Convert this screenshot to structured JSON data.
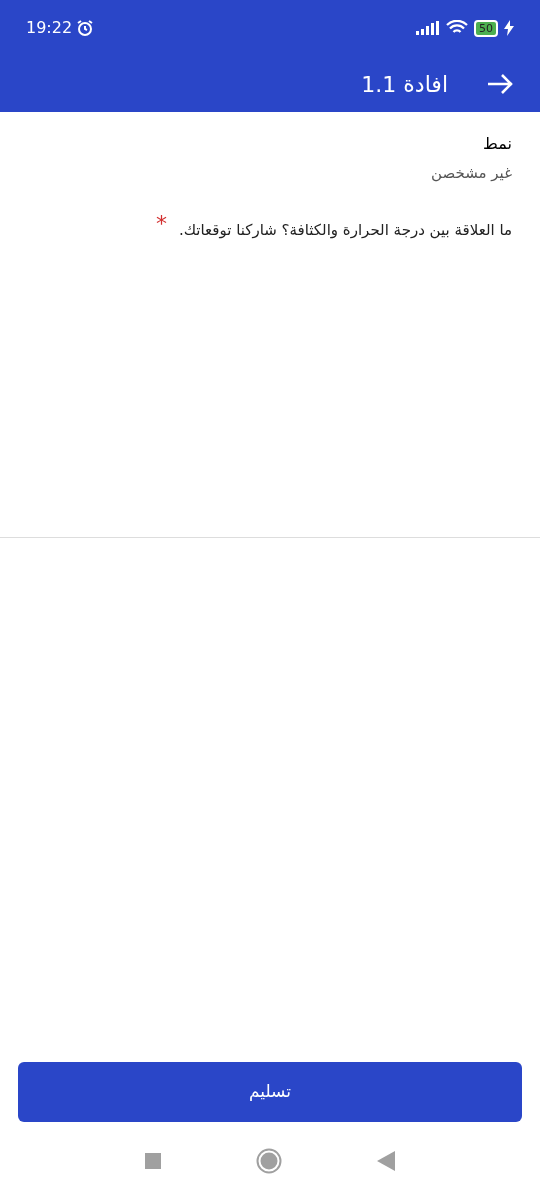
{
  "status_bar": {
    "time": "19:22",
    "battery": "50"
  },
  "header": {
    "title": "افادة 1.1"
  },
  "meta": {
    "label": "نمط",
    "value": "غير مشخصن"
  },
  "question": {
    "text": "ما العلاقة بين درجة الحرارة والكثافة؟ شاركنا توقعاتك.",
    "required": true,
    "required_mark": "*"
  },
  "submit_button": {
    "label": "تسليم"
  }
}
